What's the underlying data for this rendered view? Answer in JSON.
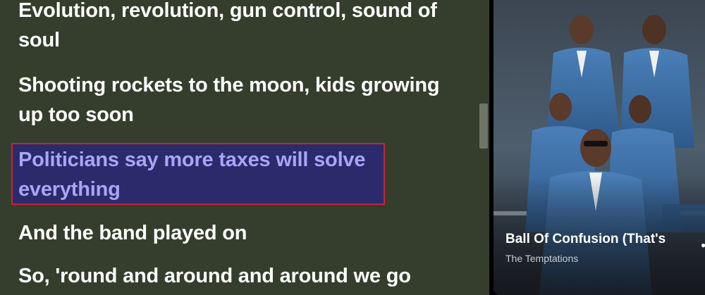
{
  "lyrics": {
    "lines": [
      "Evolution, revolution, gun control, sound of soul",
      "Shooting rockets to the moon, kids growing up too soon",
      "Politicians say more taxes will solve everything",
      "And the band played on",
      "So, 'round and around and around we go"
    ],
    "active_index": 2
  },
  "now_playing": {
    "title": "Ball Of Confusion (That's",
    "artist": "The Temptations",
    "more_icon": "more-icon"
  },
  "colors": {
    "lyrics_background": "#353e2c",
    "lyric_text": "#ffffff",
    "active_lyric_text": "#a8a6f4",
    "active_lyric_background": "#2b2a6b",
    "focus_outline": "#c4253a"
  }
}
